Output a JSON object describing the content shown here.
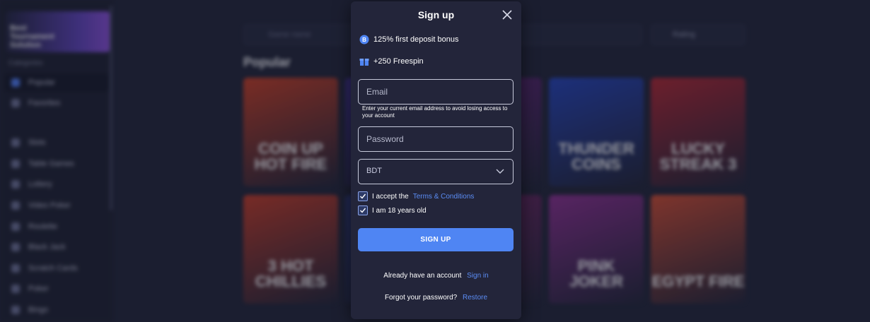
{
  "sidebar": {
    "promo_text": "Best Tournament Solution",
    "categories_title": "Categories",
    "items": [
      {
        "label": "Popular",
        "active": true
      },
      {
        "label": "Favorites"
      },
      {
        "label": "Slots"
      },
      {
        "label": "Table Games"
      },
      {
        "label": "Lottery"
      },
      {
        "label": "Video Poker"
      },
      {
        "label": "Roulette"
      },
      {
        "label": "Black Jack"
      },
      {
        "label": "Scratch Cards"
      },
      {
        "label": "Poker"
      },
      {
        "label": "Bingo"
      }
    ]
  },
  "toolbar": {
    "search_placeholder": "Game name",
    "sort_label": "Rating"
  },
  "section_title": "Popular",
  "games": [
    {
      "name": "COIN UP HOT FIRE",
      "color": "#c8391c"
    },
    {
      "name": "",
      "color": "#3b2a8a"
    },
    {
      "name": "",
      "color": "#5a1d6e"
    },
    {
      "name": "THUNDER COINS",
      "color": "#1f3fb8"
    },
    {
      "name": "LUCKY STREAK 3",
      "color": "#b0202a"
    },
    {
      "name": "3 HOT CHILLIES",
      "color": "#c4361f"
    },
    {
      "name": "",
      "color": "#25306e"
    },
    {
      "name": "",
      "color": "#6a1e5c"
    },
    {
      "name": "PINK JOKER",
      "color": "#8a2a8c"
    },
    {
      "name": "EGYPT FIRE",
      "color": "#d0482a"
    }
  ],
  "modal": {
    "title": "Sign up",
    "bonus1": "125% first deposit bonus",
    "bonus2": "+250 Freespin",
    "email_placeholder": "Email",
    "email_hint": "Enter your current email address to avoid losing access to your account",
    "password_placeholder": "Password",
    "currency": "BDT",
    "accept_prefix": "I accept the",
    "terms_link": "Terms & Conditions",
    "age_label": "I am 18 years old",
    "signup_button": "SIGN UP",
    "have_account": "Already have an account",
    "sign_in": "Sign in",
    "forgot": "Forgot your password?",
    "restore": "Restore"
  },
  "colors": {
    "accent": "#4f85f3",
    "link": "#5b8df5",
    "modal_bg": "#23253a"
  }
}
